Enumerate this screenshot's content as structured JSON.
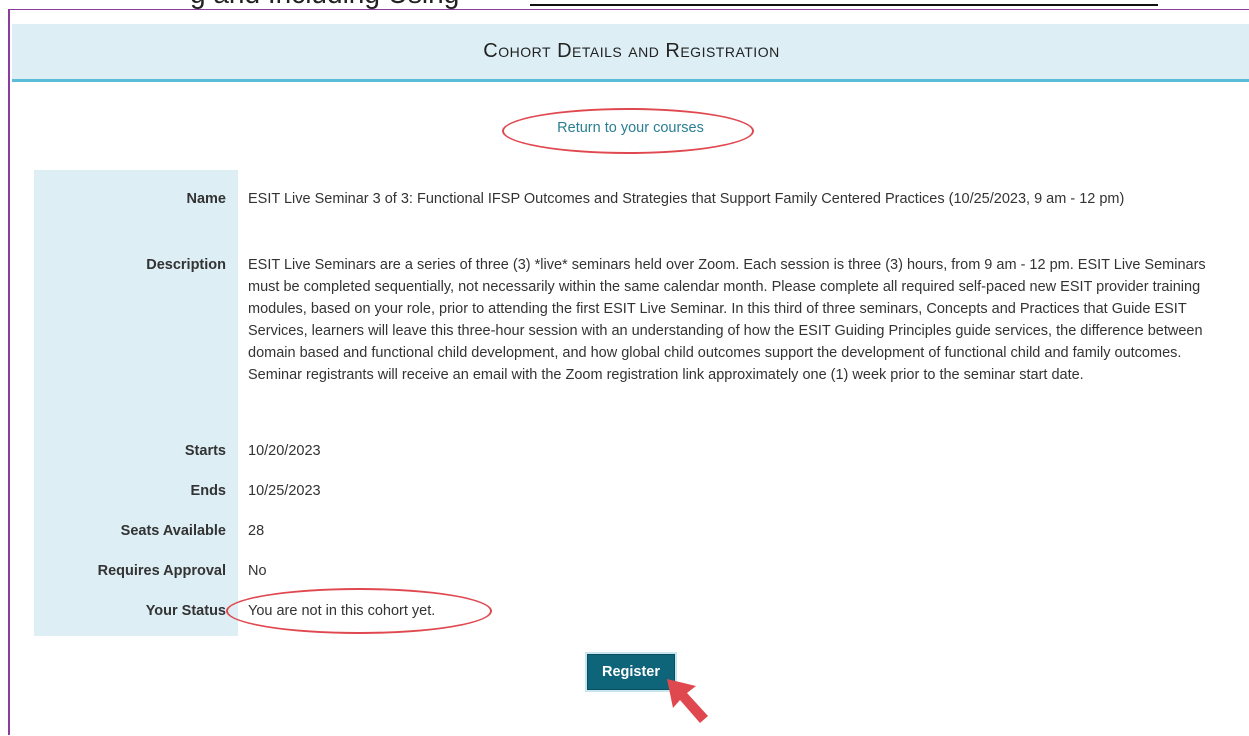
{
  "top_strip": {
    "text": "g and Including Using"
  },
  "header": {
    "title": "Cohort Details and Registration"
  },
  "return_link": "Return to your courses",
  "details": {
    "name_label": "Name",
    "name_value": "ESIT Live Seminar 3 of 3: Functional IFSP Outcomes and Strategies that Support Family Centered Practices (10/25/2023, 9 am - 12 pm)",
    "description_label": "Description",
    "description_value": "ESIT Live Seminars are a series of three (3) *live* seminars held over Zoom. Each session is three (3) hours, from 9 am - 12 pm. ESIT Live Seminars must be completed sequentially, not necessarily within the same calendar month. Please complete all required self-paced new ESIT provider training modules, based on your role, prior to attending the first ESIT Live Seminar. In this third of three seminars, Concepts and Practices that Guide ESIT Services, learners will leave this three-hour session with an understanding of how the ESIT Guiding Principles guide services, the difference between domain based and functional child development, and how global child outcomes support the development of functional child and family outcomes. Seminar registrants will receive an email with the Zoom registration link approximately one (1) week prior to the seminar start date.",
    "starts_label": "Starts",
    "starts_value": "10/20/2023",
    "ends_label": "Ends",
    "ends_value": "10/25/2023",
    "seats_label": "Seats Available",
    "seats_value": "28",
    "approval_label": "Requires Approval",
    "approval_value": "No",
    "status_label": "Your Status",
    "status_value": "You are not in this cohort yet."
  },
  "register_button": "Register",
  "annotations": {
    "highlight_color": "#e0484f",
    "arrow_icon": "pointer-arrow-icon"
  },
  "colors": {
    "header_bg": "#ddeef5",
    "header_border": "#5bbcd8",
    "link": "#2a7f93",
    "button_bg": "#0e6479",
    "frame_border": "#8a3b9c"
  }
}
